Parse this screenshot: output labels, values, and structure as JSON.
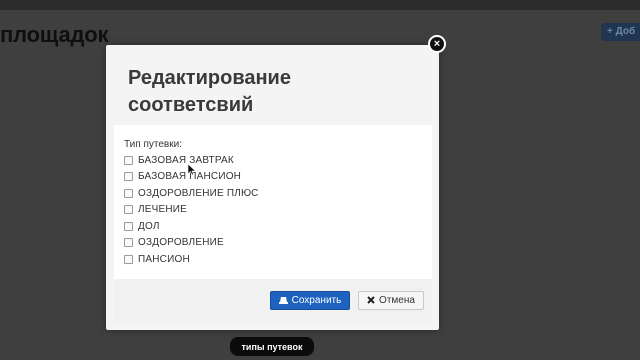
{
  "background": {
    "page_title": "площадок",
    "add_button_label": "+ Доб"
  },
  "modal": {
    "title": "Редактирование соответсвий",
    "field_label": "Тип путевки:",
    "options": [
      {
        "label": "БАЗОВАЯ ЗАВТРАК",
        "checked": false
      },
      {
        "label": "БАЗОВАЯ ПАНСИОН",
        "checked": false
      },
      {
        "label": "ОЗДОРОВЛЕНИЕ ПЛЮС",
        "checked": false
      },
      {
        "label": "ЛЕЧЕНИЕ",
        "checked": false
      },
      {
        "label": "ДОЛ",
        "checked": false
      },
      {
        "label": "ОЗДОРОВЛЕНИЕ",
        "checked": false
      },
      {
        "label": "ПАНСИОН",
        "checked": false
      }
    ],
    "save_label": "Сохранить",
    "cancel_label": "Отмена",
    "close_symbol": "×"
  },
  "icons": {
    "save": "save-icon",
    "cancel": "cancel-icon",
    "close": "close-icon"
  },
  "caption": "типы путевок",
  "colors": {
    "primary_button": "#1e62c0",
    "overlay": "#3f3f3f"
  }
}
